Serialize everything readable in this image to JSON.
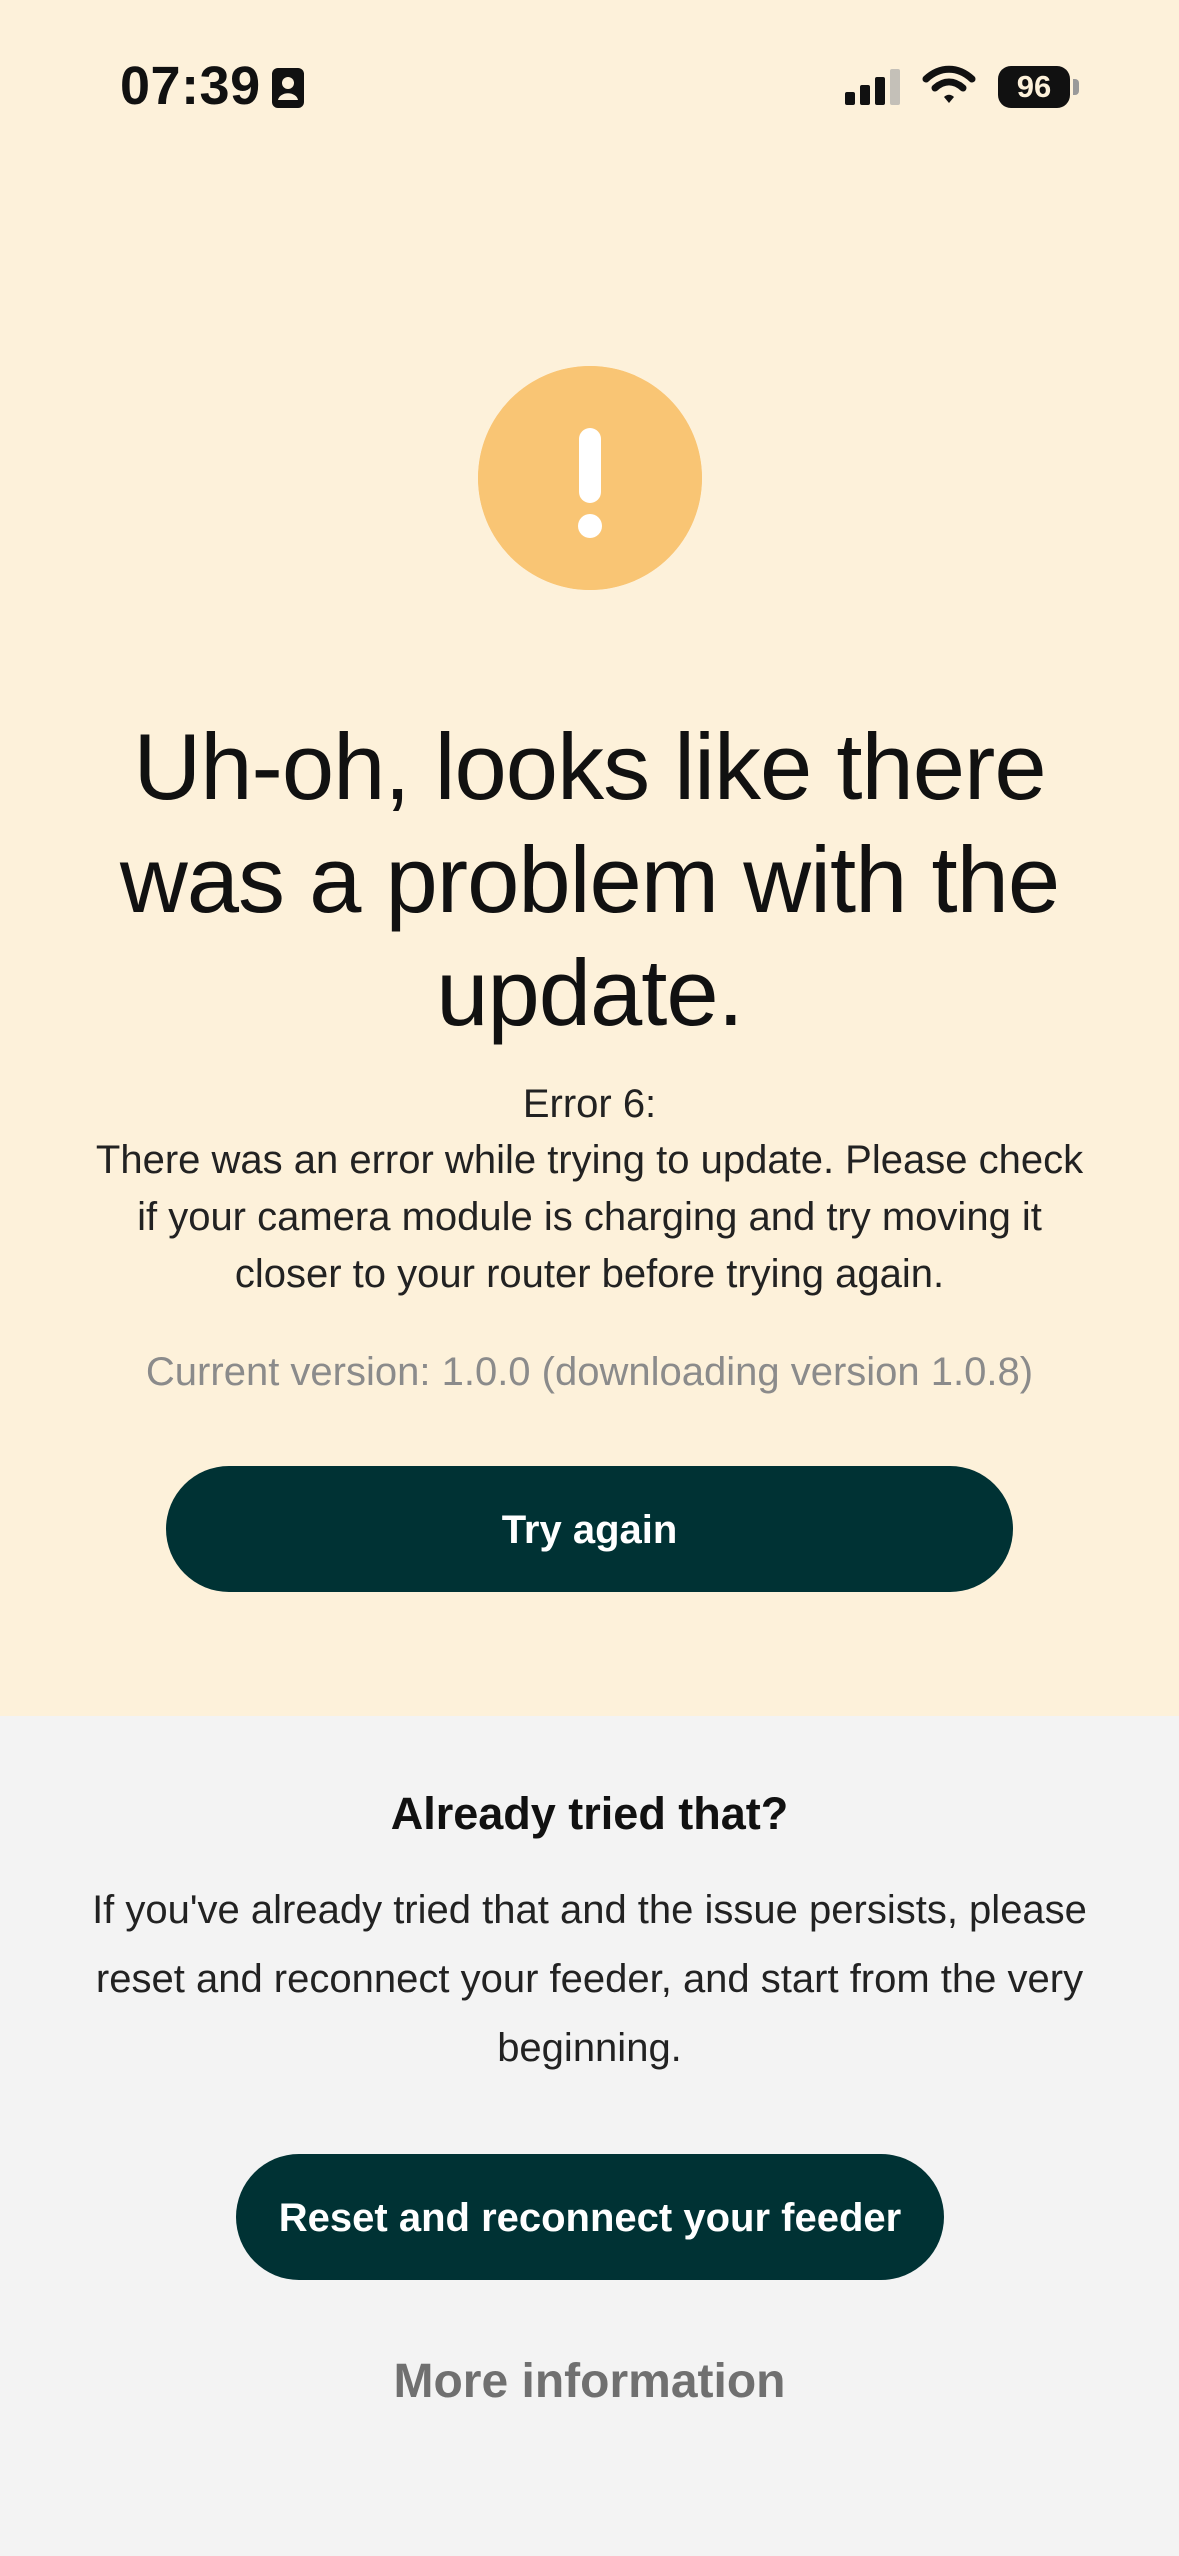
{
  "status_bar": {
    "time": "07:39",
    "battery_level": "96",
    "icons": [
      "contact-card-icon",
      "cellular-signal-icon",
      "wifi-icon",
      "battery-icon"
    ]
  },
  "alert": {
    "icon": "exclamation-icon",
    "icon_color": "#f9c574",
    "headline": "Uh-oh, looks like there was a problem with the update.",
    "error_code": "Error 6:",
    "error_message": "There was an error while trying to update. Please check if your camera module is charging and try moving it closer to your router before trying again.",
    "version": "Current version: 1.0.0 (downloading version 1.0.8)",
    "button_label": "Try again"
  },
  "help": {
    "title": "Already tried that?",
    "body": "If you've already tried that and the issue persists, please reset and reconnect your feeder, and start from the very beginning.",
    "button_label": "Reset and reconnect your feeder",
    "link_label": "More information"
  },
  "colors": {
    "top_background": "#fdf1da",
    "bottom_background": "#f3f3f3",
    "primary_button": "#003234",
    "muted_text": "#8b8b8b"
  }
}
